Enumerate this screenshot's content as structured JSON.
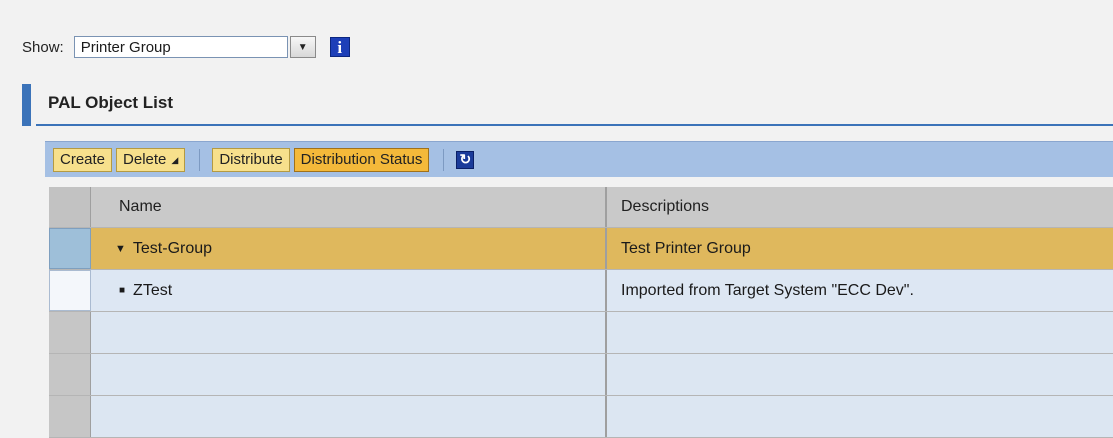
{
  "filter": {
    "label": "Show:",
    "selected": "Printer Group",
    "dropdown_icon": "chevron-down-icon",
    "info_icon": "info-icon",
    "info_glyph": "i"
  },
  "panel": {
    "title": "PAL Object List",
    "accent_color": "#3b73b9"
  },
  "toolbar": {
    "create_label": "Create",
    "delete_label": "Delete",
    "distribute_label": "Distribute",
    "distribution_status_label": "Distribution Status",
    "refresh_icon": "refresh-icon"
  },
  "table": {
    "columns": [
      "Name",
      "Descriptions"
    ],
    "rows": [
      {
        "name": "Test-Group",
        "description": "Test Printer Group",
        "type": "group",
        "expanded": true
      },
      {
        "name": "ZTest",
        "description": "Imported from Target System \"ECC Dev\".",
        "type": "child"
      }
    ]
  },
  "colors": {
    "toolbar_bg": "#a5c0e4",
    "button_bg": "#f7e08c",
    "button_active_bg": "#f4b93a",
    "group_row_bg": "#dfb85d",
    "child_row_bg": "#dde7f3"
  }
}
